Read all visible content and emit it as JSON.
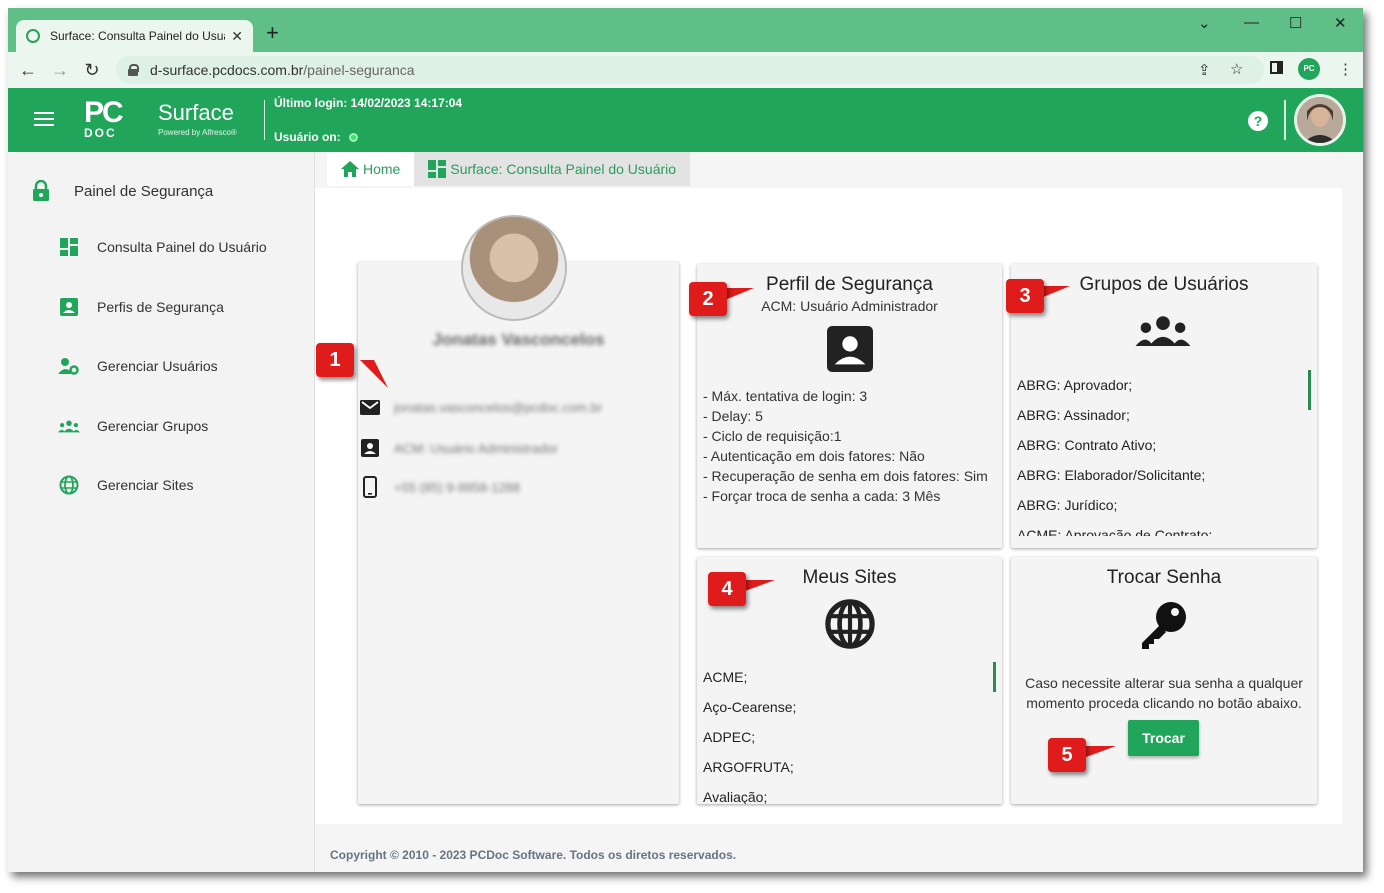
{
  "browser": {
    "tab_title": "Surface: Consulta Painel do Usuá",
    "url_host": "d-surface.pcdocs.com.br",
    "url_path": "/painel-seguranca",
    "new_tab": "+",
    "close_tab": "✕"
  },
  "header": {
    "logo_pc": "PC",
    "logo_doc": "DOC",
    "logo_surface": "Surface",
    "logo_powered": "Powered by Alfresco®",
    "last_login": "Último login: 14/02/2023 14:17:04",
    "user_on": "Usuário on:",
    "help": "?"
  },
  "sidebar": {
    "title": "Painel de Segurança",
    "items": [
      {
        "label": "Consulta Painel do Usuário",
        "icon": "dashboard-icon"
      },
      {
        "label": "Perfis de Segurança",
        "icon": "contact-card-icon"
      },
      {
        "label": "Gerenciar Usuários",
        "icon": "user-gear-icon"
      },
      {
        "label": "Gerenciar Grupos",
        "icon": "groups-icon"
      },
      {
        "label": "Gerenciar Sites",
        "icon": "globe-icon"
      }
    ]
  },
  "breadcrumb": {
    "home": "Home",
    "current": "Surface: Consulta Painel do Usuário"
  },
  "user_card": {
    "name": "Jonatas Vasconcelos",
    "email": "jonatas.vasconcelos@pcdoc.com.br",
    "profile": "ACM: Usuário Administrador",
    "phone": "+55 (85) 9-9958-1288"
  },
  "perfil_card": {
    "title": "Perfil de Segurança",
    "subtitle": "ACM: Usuário Administrador",
    "lines": [
      "- Máx. tentativa de login: 3",
      "- Delay: 5",
      "- Ciclo de requisição:1",
      "- Autenticação em dois fatores: Não",
      "- Recuperação de senha em dois fatores: Sim",
      "- Forçar troca de senha a cada: 3 Mês"
    ]
  },
  "grupos_card": {
    "title": "Grupos de Usuários",
    "items": [
      "ABRG: Aprovador;",
      "ABRG: Assinador;",
      "ABRG: Contrato Ativo;",
      "ABRG: Elaborador/Solicitante;",
      "ABRG: Jurídico;",
      "ACME: Aprovação de Contrato;"
    ]
  },
  "sites_card": {
    "title": "Meus Sites",
    "items": [
      "ACME;",
      "Aço-Cearense;",
      "ADPEC;",
      "ARGOFRUTA;",
      "Avaliação;"
    ]
  },
  "senha_card": {
    "title": "Trocar Senha",
    "text": "Caso necessite alterar sua senha a qualquer momento proceda clicando no botão abaixo.",
    "button": "Trocar"
  },
  "callouts": [
    "1",
    "2",
    "3",
    "4",
    "5"
  ],
  "footer": "Copyright © 2010 - 2023 PCDoc Software. Todos os diretos reservados.",
  "colors": {
    "brand_green": "#21a55b",
    "callout_red": "#e01b1b"
  }
}
